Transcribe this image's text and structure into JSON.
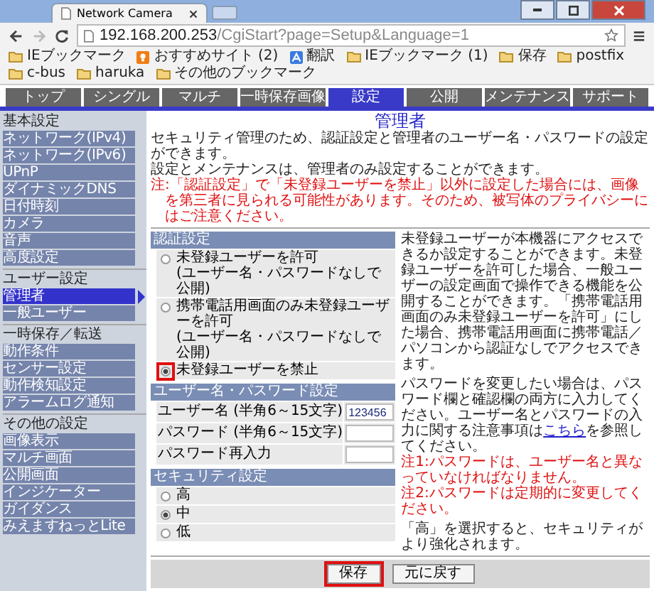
{
  "browser": {
    "tab_title": "Network Camera",
    "url_host": "192.168.200.253",
    "url_path": "/CgiStart?page=Setup&Language=1",
    "bookmarks": [
      {
        "label": "IEブックマーク",
        "kind": "folder"
      },
      {
        "label": "おすすめサイト (2)",
        "kind": "suggested"
      },
      {
        "label": "翻訳",
        "kind": "translate"
      },
      {
        "label": "IEブックマーク (1)",
        "kind": "folder"
      },
      {
        "label": "保存",
        "kind": "folder"
      },
      {
        "label": "postfix",
        "kind": "folder"
      },
      {
        "label": "c-bus",
        "kind": "folder"
      },
      {
        "label": "haruka",
        "kind": "folder"
      },
      {
        "label": "その他のブックマーク",
        "kind": "folder"
      }
    ]
  },
  "nav_tabs": [
    {
      "label": "トップ",
      "selected": false
    },
    {
      "label": "シングル",
      "selected": false
    },
    {
      "label": "マルチ",
      "selected": false
    },
    {
      "label": "一時保存画像",
      "selected": false
    },
    {
      "label": "設定",
      "selected": true
    },
    {
      "label": "公開",
      "selected": false
    },
    {
      "label": "メンテナンス",
      "selected": false
    },
    {
      "label": "サポート",
      "selected": false
    }
  ],
  "sidebar": [
    {
      "heading": "基本設定",
      "items": [
        {
          "label": "ネットワーク(IPv4)",
          "selected": false
        },
        {
          "label": "ネットワーク(IPv6)",
          "selected": false
        },
        {
          "label": "UPnP",
          "selected": false
        },
        {
          "label": "ダイナミックDNS",
          "selected": false
        },
        {
          "label": "日付時刻",
          "selected": false
        },
        {
          "label": "カメラ",
          "selected": false
        },
        {
          "label": "音声",
          "selected": false
        },
        {
          "label": "高度設定",
          "selected": false
        }
      ]
    },
    {
      "heading": "ユーザー設定",
      "items": [
        {
          "label": "管理者",
          "selected": true
        },
        {
          "label": "一般ユーザー",
          "selected": false
        }
      ]
    },
    {
      "heading": "一時保存／転送",
      "items": [
        {
          "label": "動作条件",
          "selected": false
        },
        {
          "label": "センサー設定",
          "selected": false
        },
        {
          "label": "動作検知設定",
          "selected": false
        },
        {
          "label": "アラームログ通知",
          "selected": false
        }
      ]
    },
    {
      "heading": "その他の設定",
      "items": [
        {
          "label": "画像表示",
          "selected": false
        },
        {
          "label": "マルチ画面",
          "selected": false
        },
        {
          "label": "公開画面",
          "selected": false
        },
        {
          "label": "インジケーター",
          "selected": false
        },
        {
          "label": "ガイダンス",
          "selected": false
        },
        {
          "label": "みえますねっとLite",
          "selected": false
        }
      ]
    }
  ],
  "page": {
    "title": "管理者",
    "description": [
      {
        "kind": "text",
        "text": "セキュリティ管理のため、認証設定と管理者のユーザー名・パスワードの設定ができます。"
      },
      {
        "kind": "text",
        "text": "設定とメンテナンスは、管理者のみ設定することができます。"
      },
      {
        "kind": "warning",
        "text": "注:「認証設定」で「未登録ユーザーを禁止」以外に設定した場合には、画像を第三者に見られる可能性があります。そのため、被写体のプライバシーにはご注意ください。"
      }
    ]
  },
  "auth": {
    "heading": "認証設定",
    "options": [
      {
        "label": "未登録ユーザーを許可",
        "sublabel": "(ユーザー名・パスワードなしで公開)",
        "selected": false,
        "highlighted": false
      },
      {
        "label": "携帯電話用画面のみ未登録ユーザーを許可",
        "sublabel": "(ユーザー名・パスワードなしで公開)",
        "selected": false,
        "highlighted": false
      },
      {
        "label": "未登録ユーザーを禁止",
        "selected": true,
        "highlighted": true
      }
    ],
    "note": [
      {
        "kind": "text",
        "text": "未登録ユーザーが本機器にアクセスできるか設定することができます。未登録ユーザーを許可した場合、一般ユーザーの設定画面で操作できる機能を公開することができます。「携帯電話用画面のみ未登録ユーザーを許可」にした場合、携帯電話用画面に携帯電話／パソコンから認証なしでアクセスできます。"
      }
    ]
  },
  "credentials": {
    "heading": "ユーザー名・パスワード設定",
    "fields": [
      {
        "label": "ユーザー名 (半角6～15文字)",
        "value": "123456"
      },
      {
        "label": "パスワード (半角6～15文字)"
      },
      {
        "label": "パスワード再入力"
      }
    ],
    "note": [
      {
        "kind": "linked",
        "text": "パスワードを変更したい場合は、パスワード欄と確認欄の両方に入力してください。ユーザー名とパスワードの入力に関する注意事項は",
        "link": "こちら",
        "after": "を参照してください。"
      },
      {
        "kind": "warning",
        "text": "注1:パスワードは、ユーザー名と異なっていなければなりません。"
      },
      {
        "kind": "warning",
        "text": "注2:パスワードは定期的に変更してください。"
      }
    ]
  },
  "security": {
    "heading": "セキュリティ設定",
    "options": [
      {
        "label": "高",
        "selected": false,
        "highlighted": false
      },
      {
        "label": "中",
        "selected": true,
        "highlighted": false
      },
      {
        "label": "低",
        "selected": false,
        "highlighted": false
      }
    ],
    "note": [
      {
        "kind": "text",
        "text": "「高」を選択すると、セキュリティがより強化されます。"
      }
    ]
  },
  "buttons": [
    {
      "label": "保存",
      "highlighted": true
    },
    {
      "label": "元に戻す",
      "highlighted": false
    }
  ]
}
